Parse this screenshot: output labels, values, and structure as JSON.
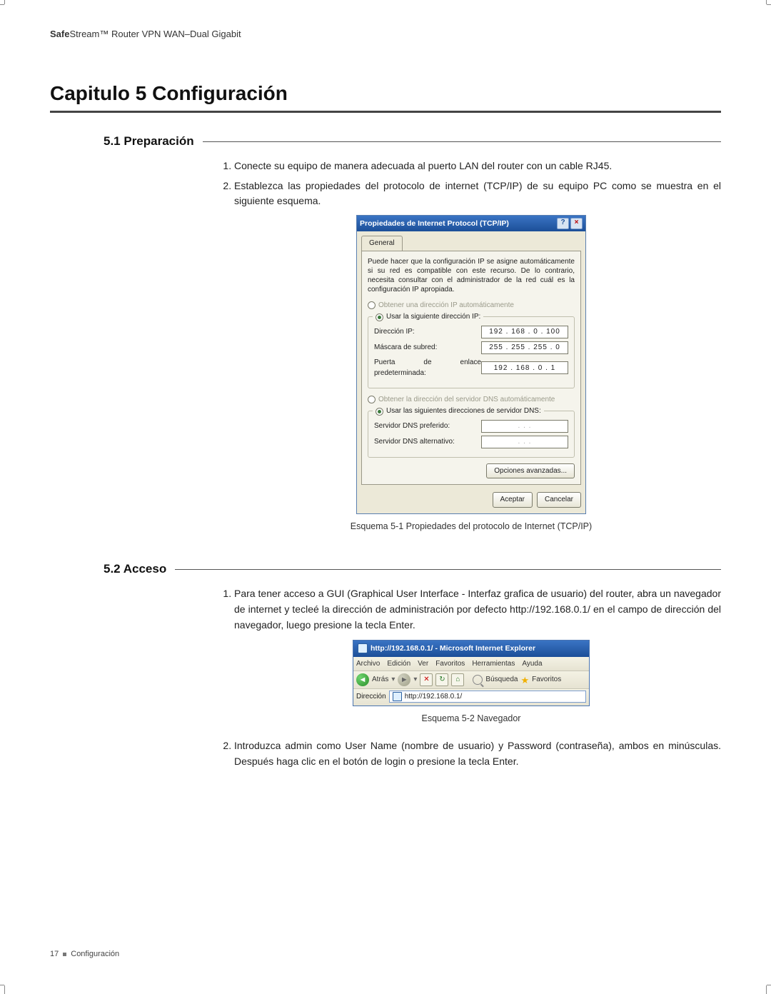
{
  "header": {
    "brand_bold": "Safe",
    "brand_light": "Stream™",
    "product": " Router VPN WAN–Dual Gigabit"
  },
  "chapter": {
    "title": "Capitulo 5  Configuración"
  },
  "sections": {
    "s1": {
      "num": "5.1",
      "title": "5.1 Preparación"
    },
    "s2": {
      "num": "5.2",
      "title": "5.2 Acceso"
    }
  },
  "steps1": {
    "a": "Conecte su equipo de manera adecuada al puerto LAN del router con un cable RJ45.",
    "b": "Establezca las propiedades del protocolo de internet (TCP/IP) de su equipo PC como se muestra en el siguiente esquema."
  },
  "dialog": {
    "title": "Propiedades de Internet Protocol (TCP/IP)",
    "tab": "General",
    "intro": "Puede hacer que la configuración IP se asigne automáticamente si su red es compatible con este recurso. De lo contrario, necesita consultar con el administrador de la red cuál es la configuración IP apropiada.",
    "r_auto_ip": "Obtener una dirección IP automáticamente",
    "r_use_ip": "Usar la siguiente dirección IP:",
    "lbl_ip": "Dirección IP:",
    "lbl_mask": "Máscara de subred:",
    "lbl_gw": "Puerta de enlace predeterminada:",
    "val_ip": "192 . 168 .  0  . 100",
    "val_mask": "255 . 255 . 255 .  0",
    "val_gw": "192 . 168 .  0  .  1",
    "r_auto_dns": "Obtener la dirección del servidor DNS automáticamente",
    "r_use_dns": "Usar las siguientes direcciones de servidor DNS:",
    "lbl_dns1": "Servidor DNS preferido:",
    "lbl_dns2": "Servidor DNS alternativo:",
    "val_dns_empty": ".       .       .",
    "btn_adv": "Opciones avanzadas...",
    "btn_ok": "Aceptar",
    "btn_cancel": "Cancelar"
  },
  "caption1": "Esquema 5-1  Propiedades del protocolo de Internet (TCP/IP)",
  "steps2": {
    "a": "Para tener acceso a GUI (Graphical User Interface - Interfaz grafica de usuario) del router, abra un navegador de internet y tecleé la dirección de administración por defecto http://192.168.0.1/ en el campo de dirección del navegador, luego presione la tecla Enter.",
    "b": "Introduzca admin como User Name (nombre de usuario) y Password (contraseña), ambos en minúsculas. Después haga clic en el botón de login o presione la tecla Enter."
  },
  "browser": {
    "title": "http://192.168.0.1/ - Microsoft Internet Explorer",
    "menu": {
      "archivo": "Archivo",
      "edicion": "Edición",
      "ver": "Ver",
      "favoritos": "Favoritos",
      "herramientas": "Herramientas",
      "ayuda": "Ayuda"
    },
    "back": "Atrás",
    "search": "Búsqueda",
    "favs": "Favoritos",
    "addr_label": "Dirección",
    "addr_value": "http://192.168.0.1/"
  },
  "caption2": "Esquema 5-2  Navegador",
  "footer": {
    "page": "17",
    "section": "Configuración"
  }
}
